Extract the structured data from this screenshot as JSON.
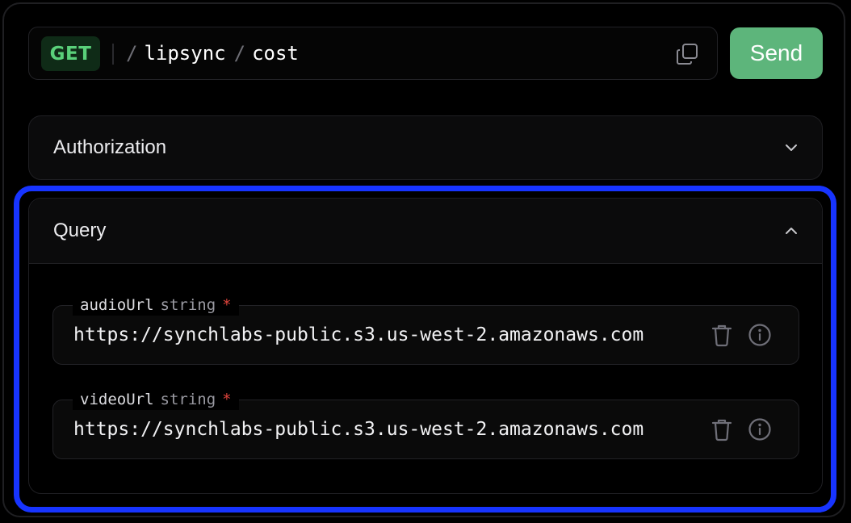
{
  "request": {
    "method": "GET",
    "path_segments": [
      "lipsync",
      "cost"
    ],
    "send_label": "Send",
    "method_color": "#5ad07a",
    "send_color": "#5db57b"
  },
  "sections": {
    "authorization": {
      "title": "Authorization",
      "icon": "chevron-down-icon"
    },
    "query": {
      "title": "Query",
      "icon": "chevron-up-icon",
      "params": [
        {
          "name": "audioUrl",
          "type": "string",
          "required_mark": "*",
          "value": "https://synchlabs-public.s3.us-west-2.amazonaws.com"
        },
        {
          "name": "videoUrl",
          "type": "string",
          "required_mark": "*",
          "value": "https://synchlabs-public.s3.us-west-2.amazonaws.com"
        }
      ]
    }
  },
  "highlight_color": "#1734ff"
}
